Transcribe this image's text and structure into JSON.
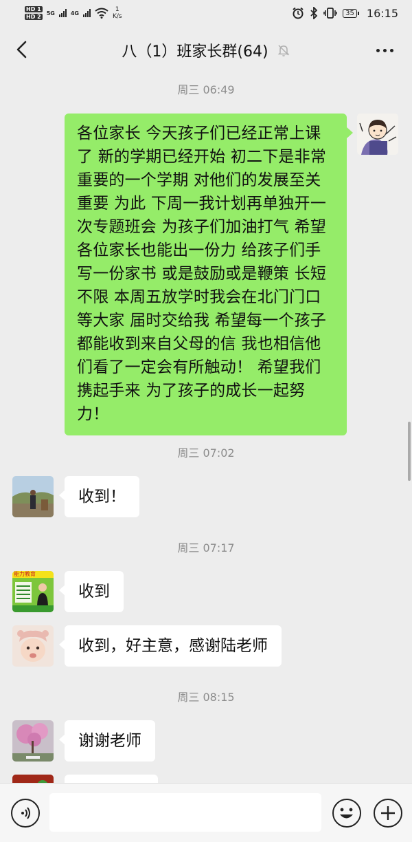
{
  "status_bar": {
    "hd1": "HD 1",
    "hd2": "HD 2",
    "signal1": "5G",
    "signal2": "4G",
    "speed_value": "1",
    "speed_unit": "K/s",
    "battery": "35",
    "time": "16:15"
  },
  "nav": {
    "title": "八（1）班家长群(64)",
    "icons": {
      "back": "chevron-left-icon",
      "mute": "bell-off-icon",
      "more": "more-dots-icon"
    }
  },
  "messages": [
    {
      "type": "timestamp",
      "text": "周三 06:49"
    },
    {
      "type": "outgoing",
      "avatar": "cartoon-boy-avatar",
      "text": "各位家长 今天孩子们已经正常上课了 新的学期已经开始 初二下是非常重要的一个学期 对他们的发展至关重要 为此 下周一我计划再单独开一次专题班会 为孩子们加油打气 希望各位家长也能出一份力 给孩子们手写一份家书 或是鼓励或是鞭策 长短不限 本周五放学时我会在北门门口等大家 届时交给我 希望每一个孩子都能收到来自父母的信 我也相信他们看了一定会有所触动！ 希望我们携起手来 为了孩子的成长一起努力！"
    },
    {
      "type": "timestamp",
      "text": "周三 07:02"
    },
    {
      "type": "incoming",
      "avatar": "outdoor-man-avatar",
      "text": "收到！"
    },
    {
      "type": "timestamp",
      "text": "周三 07:17"
    },
    {
      "type": "incoming",
      "avatar": "green-poster-avatar",
      "text": "收到"
    },
    {
      "type": "incoming",
      "avatar": "baby-avatar",
      "text": "收到，好主意，感谢陆老师"
    },
    {
      "type": "timestamp",
      "text": "周三 08:15"
    },
    {
      "type": "incoming",
      "avatar": "pink-tree-avatar",
      "text": "谢谢老师"
    },
    {
      "type": "incoming",
      "avatar": "red-avatar",
      "text": ""
    }
  ],
  "poster_text": "能力教育",
  "input_bar": {
    "placeholder": "",
    "icons": {
      "voice": "voice-icon",
      "emoji": "emoji-icon",
      "plus": "plus-icon"
    }
  },
  "colors": {
    "background": "#ededed",
    "outgoing_bubble": "#95ec69",
    "incoming_bubble": "#ffffff",
    "timestamp_text": "#8c8c8c"
  }
}
